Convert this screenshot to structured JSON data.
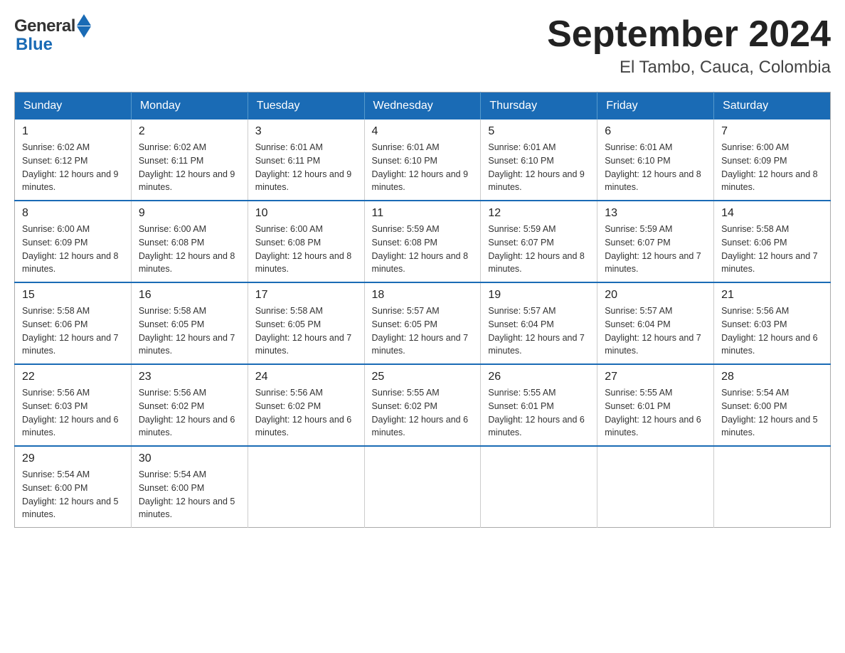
{
  "header": {
    "title": "September 2024",
    "subtitle": "El Tambo, Cauca, Colombia"
  },
  "logo": {
    "general": "General",
    "blue": "Blue"
  },
  "days_of_week": [
    "Sunday",
    "Monday",
    "Tuesday",
    "Wednesday",
    "Thursday",
    "Friday",
    "Saturday"
  ],
  "weeks": [
    [
      {
        "day": "1",
        "sunrise": "Sunrise: 6:02 AM",
        "sunset": "Sunset: 6:12 PM",
        "daylight": "Daylight: 12 hours and 9 minutes."
      },
      {
        "day": "2",
        "sunrise": "Sunrise: 6:02 AM",
        "sunset": "Sunset: 6:11 PM",
        "daylight": "Daylight: 12 hours and 9 minutes."
      },
      {
        "day": "3",
        "sunrise": "Sunrise: 6:01 AM",
        "sunset": "Sunset: 6:11 PM",
        "daylight": "Daylight: 12 hours and 9 minutes."
      },
      {
        "day": "4",
        "sunrise": "Sunrise: 6:01 AM",
        "sunset": "Sunset: 6:10 PM",
        "daylight": "Daylight: 12 hours and 9 minutes."
      },
      {
        "day": "5",
        "sunrise": "Sunrise: 6:01 AM",
        "sunset": "Sunset: 6:10 PM",
        "daylight": "Daylight: 12 hours and 9 minutes."
      },
      {
        "day": "6",
        "sunrise": "Sunrise: 6:01 AM",
        "sunset": "Sunset: 6:10 PM",
        "daylight": "Daylight: 12 hours and 8 minutes."
      },
      {
        "day": "7",
        "sunrise": "Sunrise: 6:00 AM",
        "sunset": "Sunset: 6:09 PM",
        "daylight": "Daylight: 12 hours and 8 minutes."
      }
    ],
    [
      {
        "day": "8",
        "sunrise": "Sunrise: 6:00 AM",
        "sunset": "Sunset: 6:09 PM",
        "daylight": "Daylight: 12 hours and 8 minutes."
      },
      {
        "day": "9",
        "sunrise": "Sunrise: 6:00 AM",
        "sunset": "Sunset: 6:08 PM",
        "daylight": "Daylight: 12 hours and 8 minutes."
      },
      {
        "day": "10",
        "sunrise": "Sunrise: 6:00 AM",
        "sunset": "Sunset: 6:08 PM",
        "daylight": "Daylight: 12 hours and 8 minutes."
      },
      {
        "day": "11",
        "sunrise": "Sunrise: 5:59 AM",
        "sunset": "Sunset: 6:08 PM",
        "daylight": "Daylight: 12 hours and 8 minutes."
      },
      {
        "day": "12",
        "sunrise": "Sunrise: 5:59 AM",
        "sunset": "Sunset: 6:07 PM",
        "daylight": "Daylight: 12 hours and 8 minutes."
      },
      {
        "day": "13",
        "sunrise": "Sunrise: 5:59 AM",
        "sunset": "Sunset: 6:07 PM",
        "daylight": "Daylight: 12 hours and 7 minutes."
      },
      {
        "day": "14",
        "sunrise": "Sunrise: 5:58 AM",
        "sunset": "Sunset: 6:06 PM",
        "daylight": "Daylight: 12 hours and 7 minutes."
      }
    ],
    [
      {
        "day": "15",
        "sunrise": "Sunrise: 5:58 AM",
        "sunset": "Sunset: 6:06 PM",
        "daylight": "Daylight: 12 hours and 7 minutes."
      },
      {
        "day": "16",
        "sunrise": "Sunrise: 5:58 AM",
        "sunset": "Sunset: 6:05 PM",
        "daylight": "Daylight: 12 hours and 7 minutes."
      },
      {
        "day": "17",
        "sunrise": "Sunrise: 5:58 AM",
        "sunset": "Sunset: 6:05 PM",
        "daylight": "Daylight: 12 hours and 7 minutes."
      },
      {
        "day": "18",
        "sunrise": "Sunrise: 5:57 AM",
        "sunset": "Sunset: 6:05 PM",
        "daylight": "Daylight: 12 hours and 7 minutes."
      },
      {
        "day": "19",
        "sunrise": "Sunrise: 5:57 AM",
        "sunset": "Sunset: 6:04 PM",
        "daylight": "Daylight: 12 hours and 7 minutes."
      },
      {
        "day": "20",
        "sunrise": "Sunrise: 5:57 AM",
        "sunset": "Sunset: 6:04 PM",
        "daylight": "Daylight: 12 hours and 7 minutes."
      },
      {
        "day": "21",
        "sunrise": "Sunrise: 5:56 AM",
        "sunset": "Sunset: 6:03 PM",
        "daylight": "Daylight: 12 hours and 6 minutes."
      }
    ],
    [
      {
        "day": "22",
        "sunrise": "Sunrise: 5:56 AM",
        "sunset": "Sunset: 6:03 PM",
        "daylight": "Daylight: 12 hours and 6 minutes."
      },
      {
        "day": "23",
        "sunrise": "Sunrise: 5:56 AM",
        "sunset": "Sunset: 6:02 PM",
        "daylight": "Daylight: 12 hours and 6 minutes."
      },
      {
        "day": "24",
        "sunrise": "Sunrise: 5:56 AM",
        "sunset": "Sunset: 6:02 PM",
        "daylight": "Daylight: 12 hours and 6 minutes."
      },
      {
        "day": "25",
        "sunrise": "Sunrise: 5:55 AM",
        "sunset": "Sunset: 6:02 PM",
        "daylight": "Daylight: 12 hours and 6 minutes."
      },
      {
        "day": "26",
        "sunrise": "Sunrise: 5:55 AM",
        "sunset": "Sunset: 6:01 PM",
        "daylight": "Daylight: 12 hours and 6 minutes."
      },
      {
        "day": "27",
        "sunrise": "Sunrise: 5:55 AM",
        "sunset": "Sunset: 6:01 PM",
        "daylight": "Daylight: 12 hours and 6 minutes."
      },
      {
        "day": "28",
        "sunrise": "Sunrise: 5:54 AM",
        "sunset": "Sunset: 6:00 PM",
        "daylight": "Daylight: 12 hours and 5 minutes."
      }
    ],
    [
      {
        "day": "29",
        "sunrise": "Sunrise: 5:54 AM",
        "sunset": "Sunset: 6:00 PM",
        "daylight": "Daylight: 12 hours and 5 minutes."
      },
      {
        "day": "30",
        "sunrise": "Sunrise: 5:54 AM",
        "sunset": "Sunset: 6:00 PM",
        "daylight": "Daylight: 12 hours and 5 minutes."
      },
      null,
      null,
      null,
      null,
      null
    ]
  ]
}
